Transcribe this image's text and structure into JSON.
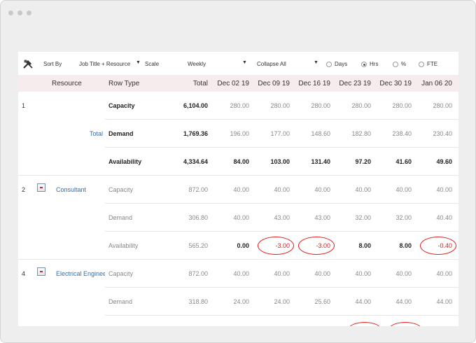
{
  "toolbar": {
    "sort_by_label": "Sort By",
    "sort_by_value": "Job Title + Resource",
    "scale_label": "Scale",
    "scale_value": "Weekly",
    "collapse_value": "Collapse All",
    "units": [
      {
        "label": "Days",
        "selected": false
      },
      {
        "label": "Hrs",
        "selected": true
      },
      {
        "label": "%",
        "selected": false
      },
      {
        "label": "FTE",
        "selected": false
      }
    ]
  },
  "table": {
    "headers": {
      "resource": "Resource",
      "row_type": "Row Type",
      "total": "Total",
      "weeks": [
        "Dec 02 19",
        "Dec 09 19",
        "Dec 16 19",
        "Dec 23 19",
        "Dec 30 19",
        "Jan 06 20"
      ]
    },
    "rows": [
      {
        "index": "1",
        "resource": "",
        "row_type": "Capacity",
        "total": "6,104.00",
        "values": [
          "280.00",
          "280.00",
          "280.00",
          "280.00",
          "280.00",
          "280.00"
        ]
      },
      {
        "index": "",
        "resource": "Total",
        "row_type": "Demand",
        "total": "1,769.36",
        "values": [
          "196.00",
          "177.00",
          "148.60",
          "182.80",
          "238.40",
          "230.40"
        ]
      },
      {
        "index": "",
        "resource": "",
        "row_type": "Availability",
        "total": "4,334.64",
        "values": [
          "84.00",
          "103.00",
          "131.40",
          "97.20",
          "41.60",
          "49.60"
        ]
      },
      {
        "index": "2",
        "resource": "Consultant",
        "row_type": "Capacity",
        "total": "872.00",
        "values": [
          "40.00",
          "40.00",
          "40.00",
          "40.00",
          "40.00",
          "40.00"
        ]
      },
      {
        "index": "",
        "resource": "",
        "row_type": "Demand",
        "total": "306.80",
        "values": [
          "40.00",
          "43.00",
          "43.00",
          "32.00",
          "32.00",
          "40.40"
        ]
      },
      {
        "index": "",
        "resource": "",
        "row_type": "Availability",
        "total": "565.20",
        "values": [
          "0.00",
          "-3.00",
          "-3.00",
          "8.00",
          "8.00",
          "-0.40"
        ]
      },
      {
        "index": "4",
        "resource": "Electrical Engineer",
        "row_type": "Capacity",
        "total": "872.00",
        "values": [
          "40.00",
          "40.00",
          "40.00",
          "40.00",
          "40.00",
          "40.00"
        ]
      },
      {
        "index": "",
        "resource": "",
        "row_type": "Demand",
        "total": "318.80",
        "values": [
          "24.00",
          "24.00",
          "25.60",
          "44.00",
          "44.00",
          "44.00"
        ]
      }
    ]
  },
  "colors": {
    "negative": "#d32020",
    "link": "#2a6fb5",
    "header_bg": "#f6ecee",
    "highlight_oval": "#e01b1b"
  }
}
